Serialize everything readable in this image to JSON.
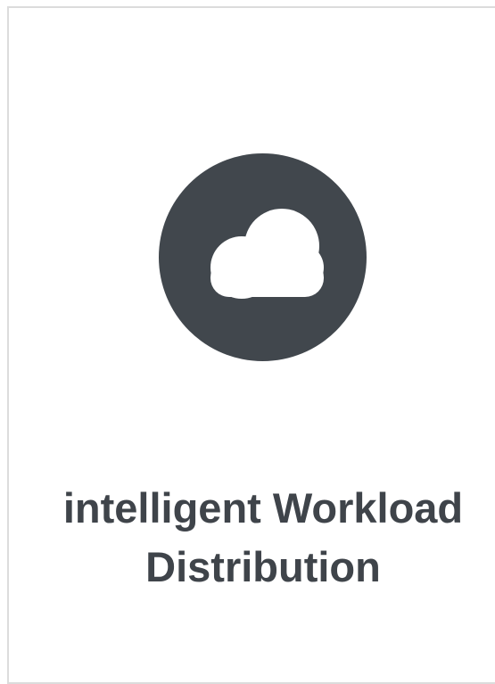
{
  "card": {
    "icon": "cloud-icon",
    "icon_bg_color": "#41474d",
    "title_line1": "intelligent Workload",
    "title_line2": "Distribution"
  }
}
